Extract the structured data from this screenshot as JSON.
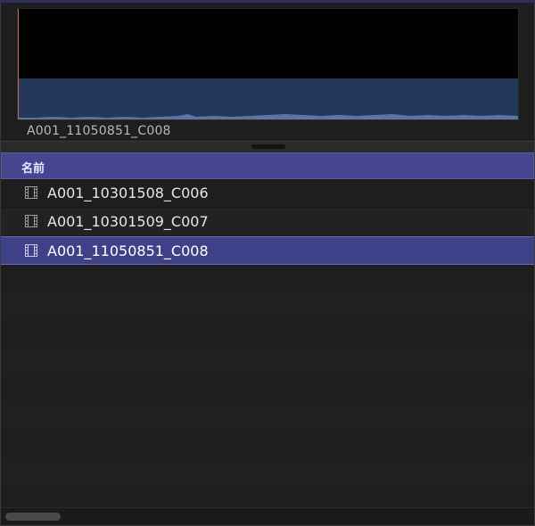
{
  "preview": {
    "clip_name": "A001_11050851_C008"
  },
  "browser": {
    "column_header": "名前",
    "items": [
      {
        "label": "A001_10301508_C006",
        "icon": "film-clip-icon",
        "selected": false
      },
      {
        "label": "A001_10301509_C007",
        "icon": "film-clip-icon",
        "selected": false
      },
      {
        "label": "A001_11050851_C008",
        "icon": "film-clip-icon",
        "selected": true
      }
    ]
  },
  "colors": {
    "header": "#45468f",
    "selection": "#3f4188",
    "audio_waveform": "#24385c",
    "playhead": "#c46a5a"
  }
}
